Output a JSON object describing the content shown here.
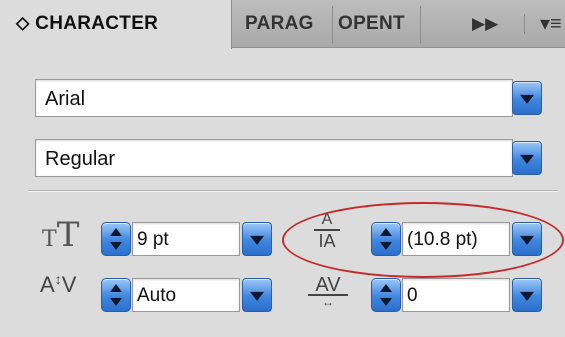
{
  "tabs": {
    "character": "⬦ CHARACTER",
    "paragraph": "PARAG",
    "opentype": "OPENT",
    "more_icon": "double-chevron-right-icon",
    "menu_icon": "panel-menu-icon"
  },
  "font": {
    "family": "Arial",
    "style": "Regular"
  },
  "size": {
    "value": "9 pt",
    "icon": "font-size-icon"
  },
  "leading": {
    "value": "(10.8 pt)",
    "icon": "leading-icon"
  },
  "kerning": {
    "value": "Auto",
    "icon": "kerning-icon"
  },
  "tracking": {
    "value": "0",
    "icon": "tracking-icon"
  },
  "colors": {
    "accent": "#3f86e0",
    "annotation": "#c42a2a"
  }
}
